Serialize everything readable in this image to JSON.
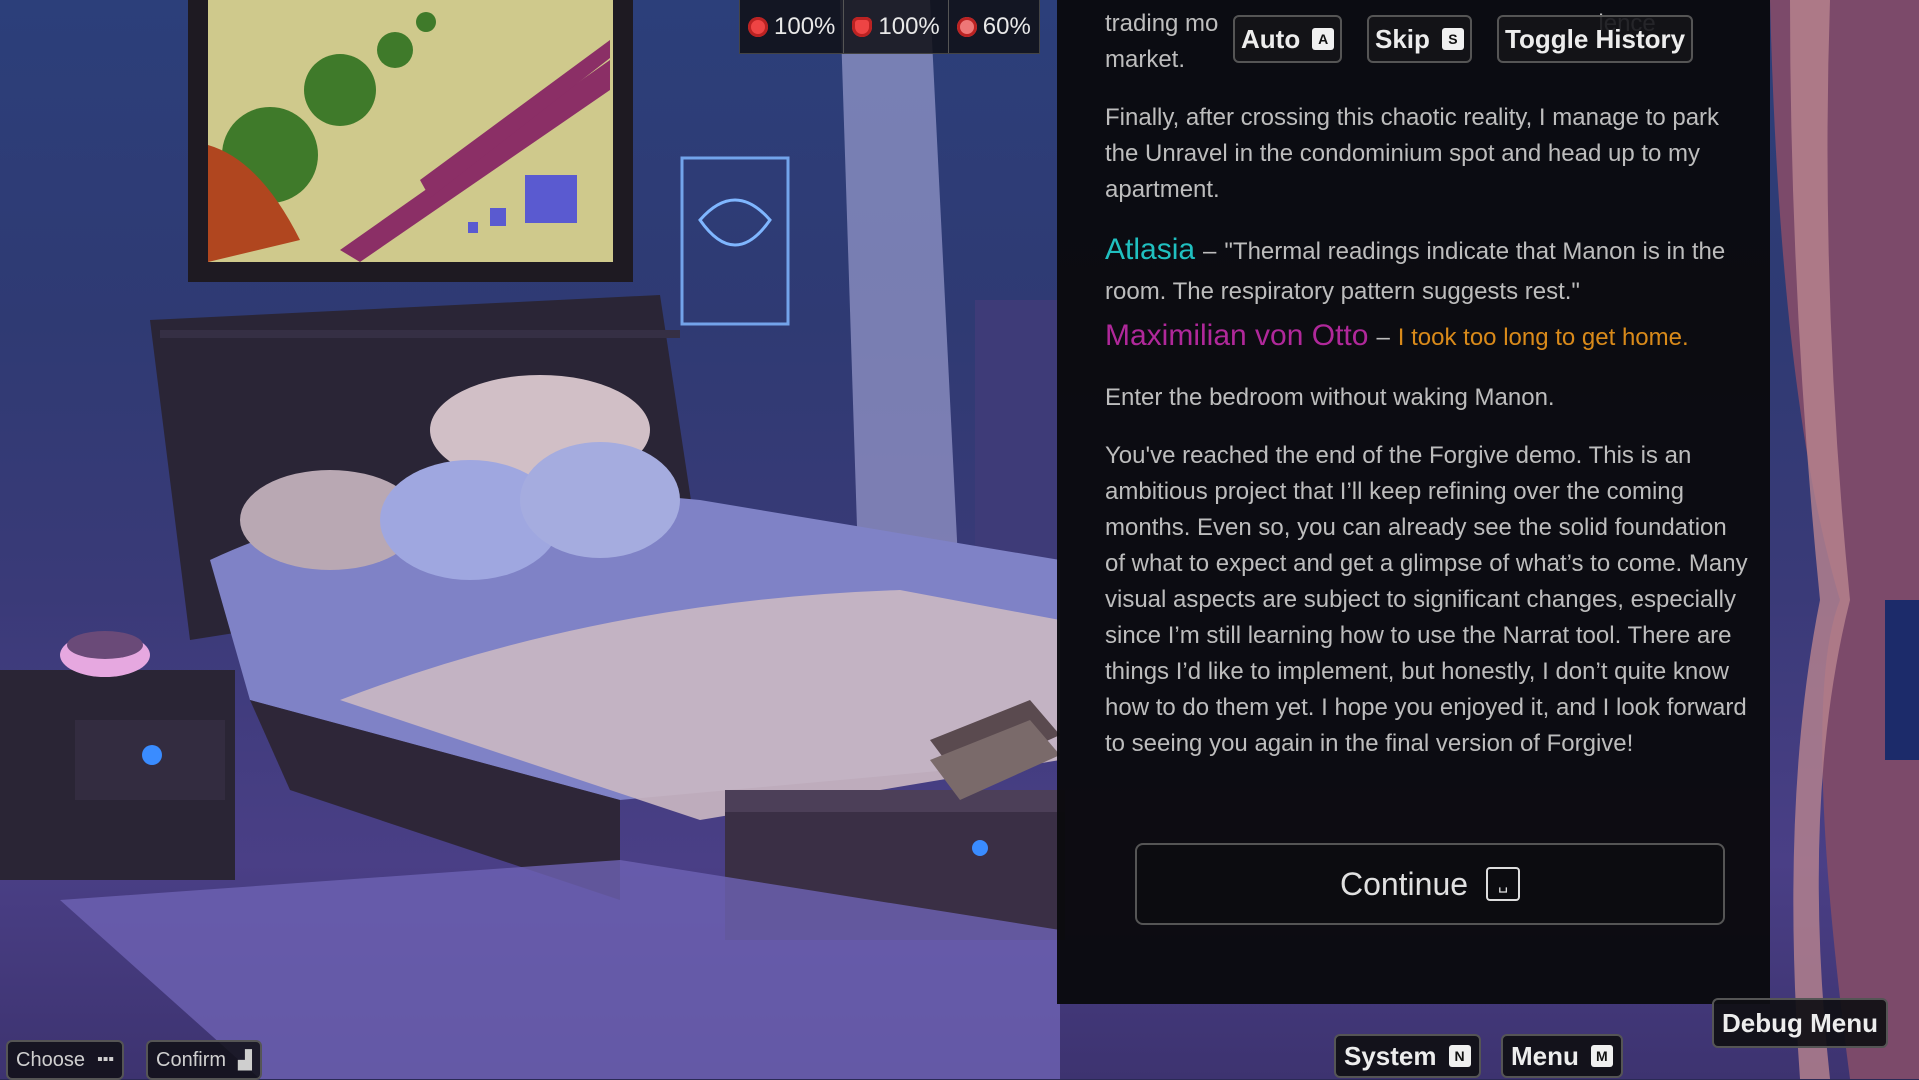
{
  "stats": [
    {
      "icon": "health-icon",
      "value": "100%"
    },
    {
      "icon": "heart-icon",
      "value": "100%"
    },
    {
      "icon": "brain-icon",
      "value": "60%"
    }
  ],
  "quick_buttons": {
    "auto": {
      "label": "Auto",
      "key": "A"
    },
    "skip": {
      "label": "Skip",
      "key": "S"
    },
    "history": {
      "label": "Toggle History"
    }
  },
  "dialog": {
    "intro_partial": "trading m...ality f...fficiency of a private violence market.",
    "intro_line1": "trading mo",
    "intro_line1_end": "lence",
    "intro_line2": "market.",
    "para1": "Finally, after crossing this chaotic reality, I manage to park the Unravel in the condominium spot and head up to my apartment.",
    "atlasia": {
      "speaker": "Atlasia",
      "dash": "–",
      "text": "\"Thermal readings indicate that Manon is in the room. The respiratory pattern suggests rest.\""
    },
    "max": {
      "speaker": "Maximilian von Otto",
      "dash": "–",
      "text": "I took too long to get home."
    },
    "para2": "Enter the bedroom without waking Manon.",
    "para3": "You've reached the end of the Forgive demo. This is an ambitious project that I’ll keep refining over the coming months. Even so, you can already see the solid foundation of what to expect and get a glimpse of what’s to come. Many visual aspects are subject to significant changes, especially since I’m still learning how to use the Narrat tool. There are things I’d like to implement, but honestly, I don’t quite know how to do them yet. I hope you enjoyed it, and I look forward to seeing you again in the final version of Forgive!"
  },
  "continue": {
    "label": "Continue",
    "key_icon": "space-key-icon"
  },
  "debug_menu": {
    "label": "Debug Menu"
  },
  "bottom_buttons": {
    "system": {
      "label": "System",
      "key": "N"
    },
    "menu": {
      "label": "Menu",
      "key": "M"
    }
  },
  "controls": {
    "choose": {
      "label": "Choose",
      "icon": "dpad-icon"
    },
    "confirm": {
      "label": "Confirm",
      "icon": "button-icon"
    }
  },
  "colors": {
    "atlasia": "#20c0c0",
    "max": "#b0289a",
    "max_text": "#d98a1a"
  }
}
